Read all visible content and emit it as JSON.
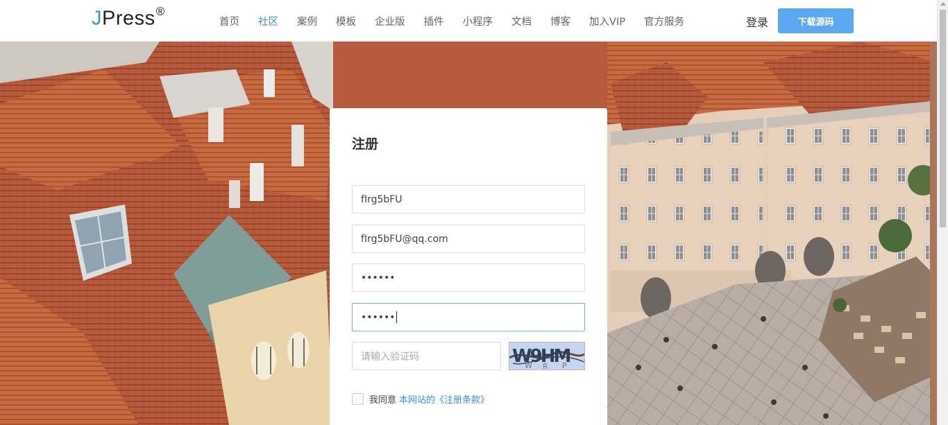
{
  "header": {
    "logo_text": "JPress",
    "logo_mark": "®",
    "nav": [
      "首页",
      "社区",
      "案例",
      "模板",
      "企业版",
      "插件",
      "小程序",
      "文档",
      "博客",
      "加入VIP",
      "官方服务"
    ],
    "active_nav": "社区",
    "login_label": "登录",
    "download_label": "下载源码"
  },
  "register": {
    "title": "注册",
    "username_value": "fIrg5bFU",
    "email_value": "fIrg5bFU@qq.com",
    "password_value": "••••••",
    "confirm_password_value": "••••••",
    "captcha_placeholder": "请输入验证码",
    "captcha_text": "W9HM",
    "agree_prefix": "我同意",
    "agree_link": "本网站的《注册条款》"
  },
  "colors": {
    "accent": "#3d8fe0",
    "button": "#5ba8f0",
    "roof": "#b65a3e",
    "facade": "#e6cfba"
  },
  "icons": {
    "scroll_up": "triangle-up-icon"
  }
}
